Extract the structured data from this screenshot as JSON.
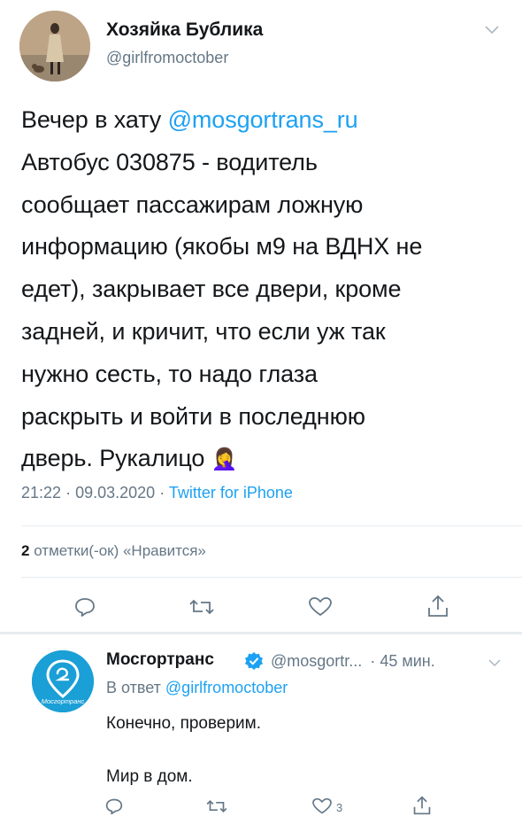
{
  "tweet": {
    "author_name": "Хозяйка Бублика",
    "author_handle": "@girlfromoctober",
    "text_before_mention": "Вечер в хату ",
    "mention": "@mosgortrans_ru",
    "text_after_mention": "\nАвтобус 030875 - водитель\nсообщает пассажирам ложную\nинформацию (якобы м9 на ВДНХ не\nедет), закрывает все двери, кроме\nзадней, и кричит, что если уж так\nнужно сесть, то надо глаза\nраскрыть и войти в последнюю\nдверь. Рукалицо ",
    "emoji": "🤦‍♀️",
    "time": "21:22",
    "date": "09.03.2020",
    "source": "Twitter for iPhone",
    "separator": "·",
    "likes_count": "2",
    "likes_label": "отметки(-ок) «Нравится»"
  },
  "reply": {
    "author_name": "Мосгортранс",
    "author_handle": "@mosgortr...",
    "age": "· 45 мин.",
    "in_reply_prefix": "В ответ",
    "in_reply_handle": "@girlfromoctober",
    "line1": "Конечно, проверим.",
    "line2": "Мир в дом.",
    "like_count": "3",
    "avatar_text": "Мосгортранс"
  },
  "icons": {
    "main_actions": [
      "reply-icon",
      "retweet-icon",
      "like-icon",
      "share-icon"
    ],
    "reply_actions": [
      "reply-icon",
      "retweet-icon",
      "like-icon",
      "share-icon"
    ],
    "chevron": "chevron-down-icon",
    "verified": "verified-badge-icon"
  },
  "colors": {
    "accent": "#1da1f2",
    "muted": "#657786",
    "text": "#14171a",
    "divider": "#e6ecf0"
  }
}
